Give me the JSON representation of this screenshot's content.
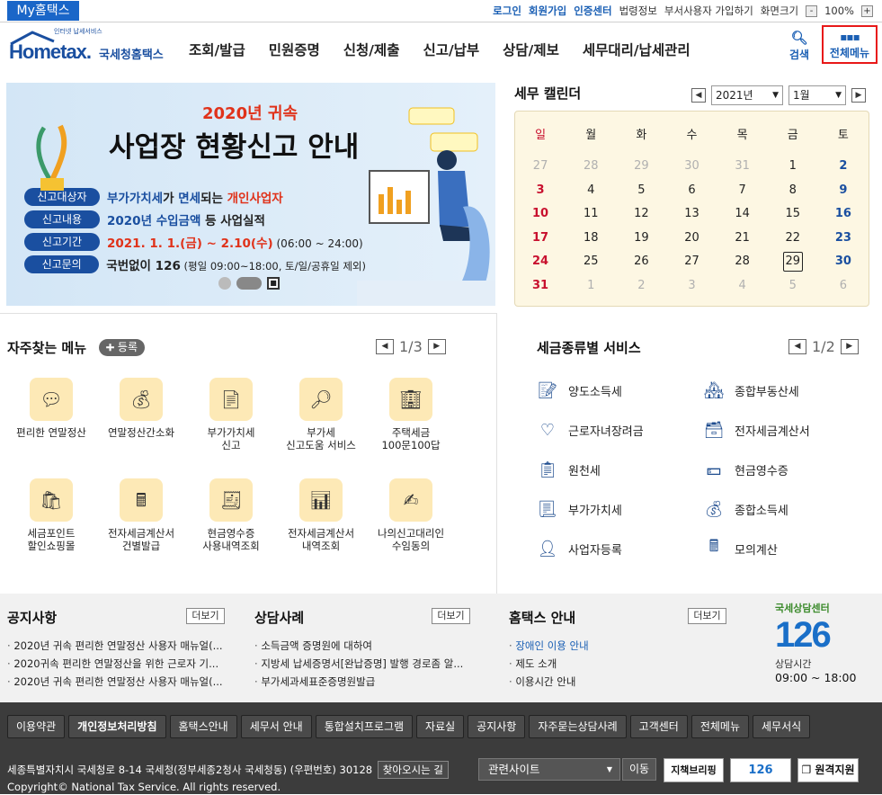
{
  "topbar": {
    "my_home": "My홈택스",
    "links": [
      "로그인",
      "회원가입",
      "인증센터",
      "법령정보",
      "부서사용자 가입하기",
      "화면크기"
    ],
    "zoom_value": "100%",
    "zoom_minus": "-",
    "zoom_plus": "+"
  },
  "header": {
    "logo_small": "인터넷 납세서비스",
    "logo_main": "Hometax.",
    "logo_sub": "국세청홈택스",
    "nav": [
      "조회/발급",
      "민원증명",
      "신청/제출",
      "신고/납부",
      "상담/제보",
      "세무대리/납세관리"
    ],
    "search_label": "검색",
    "all_menu_label": "전체메뉴"
  },
  "banner": {
    "kicker": "2020년 귀속",
    "title": "사업장 현황신고 안내",
    "rows": [
      {
        "tag": "신고대상자",
        "text1": "부가가치세",
        "text2": "가 ",
        "text3": "면세",
        "text4": "되는 ",
        "text5": "개인사업자"
      },
      {
        "tag": "신고내용",
        "text1": "2020년 수입금액",
        "text2": " 등 사업실적"
      },
      {
        "tag": "신고기간",
        "text1": "2021. 1. 1.(금) ~ 2.10(수)",
        "text2": " (06:00 ~ 24:00)"
      },
      {
        "tag": "신고문의",
        "text1": "국번없이 126",
        "text2": " (평일 09:00~18:00, 토/일/공휴일 제외)"
      }
    ]
  },
  "calendar": {
    "title": "세무 캘린더",
    "year": "2021년",
    "month": "1월",
    "weekdays": [
      "일",
      "월",
      "화",
      "수",
      "목",
      "금",
      "토"
    ],
    "days": [
      "27",
      "28",
      "29",
      "30",
      "31",
      "1",
      "2",
      "3",
      "4",
      "5",
      "6",
      "7",
      "8",
      "9",
      "10",
      "11",
      "12",
      "13",
      "14",
      "15",
      "16",
      "17",
      "18",
      "19",
      "20",
      "21",
      "22",
      "23",
      "24",
      "25",
      "26",
      "27",
      "28",
      "29",
      "30",
      "31",
      "1",
      "2",
      "3",
      "4",
      "5",
      "6"
    ],
    "today": "29",
    "colors": {
      "sunday": "#c8102e",
      "saturday": "#1a4fa0",
      "faded": "#b0b0b0"
    }
  },
  "favorites": {
    "title": "자주찾는 메뉴",
    "add_label": "등록",
    "page": "1/3",
    "items": [
      {
        "label1": "편리한 연말정산",
        "label2": "",
        "icon": "coin-bubble-icon"
      },
      {
        "label1": "연말정산간소화",
        "label2": "",
        "icon": "money-bag-icon"
      },
      {
        "label1": "부가가치세",
        "label2": "신고",
        "icon": "vat-doc-icon"
      },
      {
        "label1": "부가세",
        "label2": "신고도움 서비스",
        "icon": "won-search-icon"
      },
      {
        "label1": "주택세금",
        "label2": "100문100답",
        "icon": "building-icon"
      },
      {
        "label1": "세금포인트",
        "label2": "할인쇼핑몰",
        "icon": "shopping-bag-icon"
      },
      {
        "label1": "전자세금계산서",
        "label2": "건별발급",
        "icon": "calculator-icon"
      },
      {
        "label1": "현금영수증",
        "label2": "사용내역조회",
        "icon": "receipt-search-icon"
      },
      {
        "label1": "전자세금계산서",
        "label2": "내역조회",
        "icon": "invoice-search-icon"
      },
      {
        "label1": "나의신고대리인",
        "label2": "수임동의",
        "icon": "sign-doc-icon"
      }
    ]
  },
  "taxservice": {
    "title": "세금종류별 서비스",
    "page": "1/2",
    "items": [
      {
        "label": "양도소득세",
        "icon": "transfer-doc-icon"
      },
      {
        "label": "종합부동산세",
        "icon": "property-icon"
      },
      {
        "label": "근로자녀장려금",
        "icon": "heart-hands-icon"
      },
      {
        "label": "전자세금계산서",
        "icon": "e-invoice-icon"
      },
      {
        "label": "원천세",
        "icon": "withholding-icon"
      },
      {
        "label": "현금영수증",
        "icon": "cash-receipt-icon"
      },
      {
        "label": "부가가치세",
        "icon": "vat-icon"
      },
      {
        "label": "종합소득세",
        "icon": "income-bag-icon"
      },
      {
        "label": "사업자등록",
        "icon": "person-icon"
      },
      {
        "label": "모의계산",
        "icon": "calc-icon"
      }
    ]
  },
  "notice": {
    "title": "공지사항",
    "more": "더보기",
    "items": [
      "2020년 귀속 편리한 연말정산 사용자 매뉴얼(...",
      "2020귀속 편리한 연말정산을 위한 근로자 기...",
      "2020년 귀속 편리한 연말정산 사용자 매뉴얼(..."
    ]
  },
  "cases": {
    "title": "상담사례",
    "more": "더보기",
    "items": [
      "소득금액 증명원에 대하여",
      "지방세 납세증명서[완납증명] 발행 경로좀 알...",
      "부가세과세표준증명원발급"
    ]
  },
  "guide": {
    "title": "홈택스 안내",
    "more": "더보기",
    "items": [
      "장애인 이용 안내",
      "제도 소개",
      "이용시간 안내"
    ]
  },
  "callcenter": {
    "label": "국세상담센터",
    "number": "126",
    "hours_label": "상담시간",
    "hours": "09:00 ~ 18:00"
  },
  "footer": {
    "buttons": [
      "이용약관",
      "개인정보처리방침",
      "홈택스안내",
      "세무서 안내",
      "통합설치프로그램",
      "자료실",
      "공지사항",
      "자주묻는상담사례",
      "고객센터",
      "전체메뉴",
      "세무서식"
    ],
    "address": "세종특별자치시 국세청로 8-14 국세청(정부세종2청사 국세청동) (우편번호) 30128",
    "directions": "찾아오시는 길",
    "related_site": "관련사이트",
    "go": "이동",
    "briefing": "지책브리핑",
    "callcenter_small": "126",
    "remote": "원격지원",
    "copyright": "Copyright© National Tax Service. All rights reserved."
  }
}
